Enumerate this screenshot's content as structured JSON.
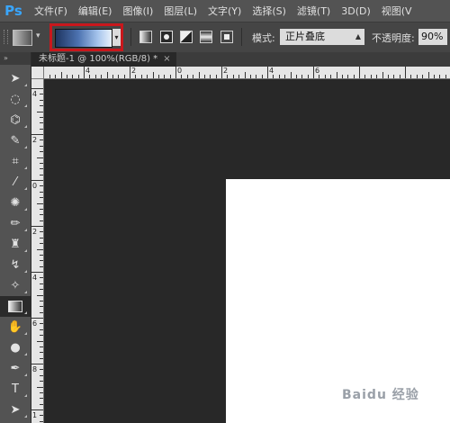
{
  "app": {
    "logo": "Ps"
  },
  "menu": [
    "文件(F)",
    "编辑(E)",
    "图像(I)",
    "图层(L)",
    "文字(Y)",
    "选择(S)",
    "滤镜(T)",
    "3D(D)",
    "视图(V"
  ],
  "options": {
    "gradient_preset": "gradient-swatch-blue",
    "gradient_types": [
      "linear",
      "radial",
      "angle",
      "reflected",
      "diamond"
    ],
    "selected_gradient_type": "radial",
    "mode_label": "模式:",
    "mode_value": "正片叠底",
    "opacity_label": "不透明度:",
    "opacity_value": "90%"
  },
  "document": {
    "tab_label": "未标题-1 @ 100%(RGB/8) *",
    "close_glyph": "×"
  },
  "rulers": {
    "horizontal_labels": [
      "6",
      "4",
      "2",
      "0",
      "2",
      "4",
      "6"
    ],
    "vertical_labels": [
      "4",
      "2",
      "0",
      "2",
      "4",
      "6",
      "8",
      "1"
    ]
  },
  "toolbar": {
    "header": "»",
    "tools": [
      {
        "name": "move-tool",
        "icon": "move-icon",
        "glyph": "➤"
      },
      {
        "name": "marquee-tool",
        "icon": "ellipse-marquee-icon",
        "glyph": "◌"
      },
      {
        "name": "lasso-tool",
        "icon": "polygonal-lasso-icon",
        "glyph": "⌬"
      },
      {
        "name": "quick-selection-tool",
        "icon": "quick-selection-icon",
        "glyph": "✎"
      },
      {
        "name": "crop-tool",
        "icon": "crop-icon",
        "glyph": "⌗"
      },
      {
        "name": "eyedropper-tool",
        "icon": "eyedropper-icon",
        "glyph": "⁄"
      },
      {
        "name": "healing-brush-tool",
        "icon": "healing-brush-icon",
        "glyph": "✺"
      },
      {
        "name": "brush-tool",
        "icon": "brush-icon",
        "glyph": "✏"
      },
      {
        "name": "clone-stamp-tool",
        "icon": "clone-stamp-icon",
        "glyph": "♜"
      },
      {
        "name": "history-brush-tool",
        "icon": "history-brush-icon",
        "glyph": "↯"
      },
      {
        "name": "eraser-tool",
        "icon": "eraser-icon",
        "glyph": "✧"
      },
      {
        "name": "gradient-tool",
        "icon": "gradient-icon",
        "glyph": ""
      },
      {
        "name": "blur-tool",
        "icon": "blur-icon",
        "glyph": "✋"
      },
      {
        "name": "dodge-tool",
        "icon": "dodge-icon",
        "glyph": "●"
      },
      {
        "name": "pen-tool",
        "icon": "pen-icon",
        "glyph": "✒"
      },
      {
        "name": "type-tool",
        "icon": "type-icon",
        "glyph": "T"
      },
      {
        "name": "path-selection-tool",
        "icon": "path-selection-icon",
        "glyph": "➤"
      }
    ]
  },
  "watermark": {
    "text": "Baidu 经验"
  },
  "colors": {
    "highlight": "#c9171c",
    "canvas": "#ffffff",
    "workspace": "#282828"
  }
}
